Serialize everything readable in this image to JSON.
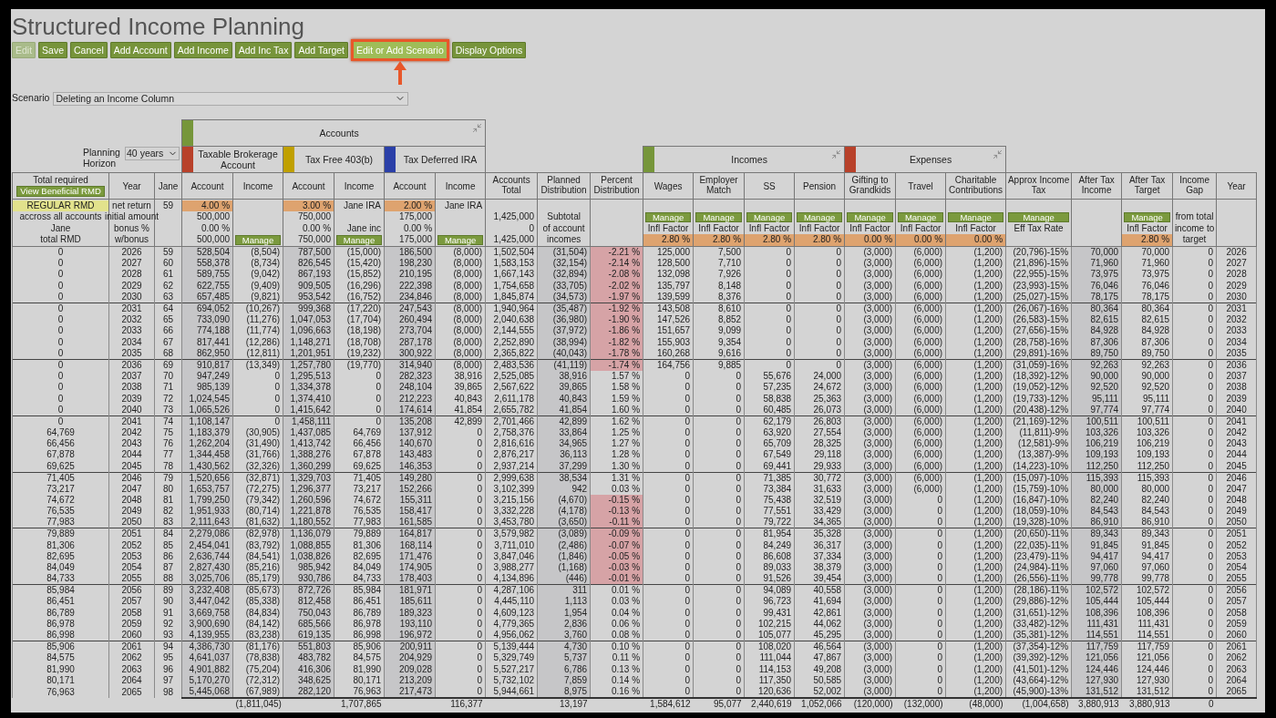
{
  "title": "Structured Income Planning",
  "toolbar": [
    {
      "label": "Edit",
      "disabled": true,
      "highlighted": false
    },
    {
      "label": "Save",
      "disabled": false,
      "highlighted": false
    },
    {
      "label": "Cancel",
      "disabled": false,
      "highlighted": false
    },
    {
      "label": "Add Account",
      "disabled": false,
      "highlighted": false
    },
    {
      "label": "Add Income",
      "disabled": false,
      "highlighted": false
    },
    {
      "label": "Add Inc Tax",
      "disabled": false,
      "highlighted": false
    },
    {
      "label": "Add Target",
      "disabled": false,
      "highlighted": false
    },
    {
      "label": "Edit or Add Scenario",
      "disabled": false,
      "highlighted": true
    },
    {
      "label": "Display Options",
      "disabled": false,
      "highlighted": false
    }
  ],
  "scenario": {
    "label": "Scenario",
    "value": "Deleting an Income Column"
  },
  "planning_horizon": {
    "label": "Planning Horizon",
    "value": "40 years"
  },
  "account_group": {
    "label": "Accounts",
    "color": "#76963a",
    "accounts": [
      {
        "label": "Taxable Brokerage Account",
        "color": "#b8412a"
      },
      {
        "label": "Tax Free 403(b)",
        "color": "#c0a000"
      },
      {
        "label": "Tax Deferred IRA",
        "color": "#2a3fa8"
      }
    ]
  },
  "flow_groups": [
    {
      "label": "Incomes",
      "color": "#76963a"
    },
    {
      "label": "Expenses",
      "color": "#b8412a"
    }
  ],
  "columns": [
    {
      "header": "Total required",
      "kind": "rmd",
      "shaded": false,
      "button": "View Beneficial RMD",
      "settings": [
        {
          "kind": "flag",
          "text": "REGULAR RMD"
        },
        {
          "kind": "text",
          "text": "accross all accounts"
        },
        {
          "kind": "text",
          "text": "Jane"
        },
        {
          "kind": "text",
          "text": "total RMD"
        }
      ]
    },
    {
      "header": "Year",
      "kind": "year",
      "shaded": false,
      "settings": [
        {
          "kind": "text",
          "text": "net return"
        },
        {
          "kind": "text",
          "text": "initial amount"
        },
        {
          "kind": "text",
          "text": "bonus %"
        },
        {
          "kind": "text",
          "text": "w/bonus"
        }
      ]
    },
    {
      "header": "Jane",
      "kind": "age",
      "shaded": false,
      "settings": [
        {
          "kind": "text",
          "text": "59"
        },
        {
          "kind": "blank"
        },
        {
          "kind": "blank"
        },
        {
          "kind": "blank"
        }
      ]
    },
    {
      "header": "Account",
      "kind": "amount",
      "shaded": true,
      "settings": [
        {
          "kind": "rate",
          "text": "4.00 %"
        },
        {
          "kind": "value",
          "text": "500,000"
        },
        {
          "kind": "value",
          "text": "0.00 %"
        },
        {
          "kind": "value",
          "text": "500,000"
        }
      ]
    },
    {
      "header": "Income",
      "kind": "amount",
      "shaded": false,
      "total": "(1,811,045)",
      "settings": [
        {
          "kind": "blank"
        },
        {
          "kind": "blank"
        },
        {
          "kind": "blank"
        },
        {
          "kind": "manage",
          "text": "Manage"
        }
      ]
    },
    {
      "header": "Account",
      "kind": "amount",
      "shaded": true,
      "settings": [
        {
          "kind": "rate",
          "text": "3.00 %"
        },
        {
          "kind": "value",
          "text": "750,000"
        },
        {
          "kind": "value",
          "text": "0.00 %"
        },
        {
          "kind": "value",
          "text": "750,000"
        }
      ]
    },
    {
      "header": "Income",
      "kind": "amount",
      "shaded": false,
      "total": "1,707,865",
      "settings": [
        {
          "kind": "value",
          "text": "Jane IRA"
        },
        {
          "kind": "blank"
        },
        {
          "kind": "value",
          "text": "Jane inc"
        },
        {
          "kind": "manage",
          "text": "Manage"
        }
      ]
    },
    {
      "header": "Account",
      "kind": "amount",
      "shaded": true,
      "settings": [
        {
          "kind": "rate",
          "text": "2.00 %"
        },
        {
          "kind": "value",
          "text": "175,000"
        },
        {
          "kind": "value",
          "text": "0.00 %"
        },
        {
          "kind": "value",
          "text": "175,000"
        }
      ]
    },
    {
      "header": "Income",
      "kind": "amount",
      "shaded": false,
      "total": "116,377",
      "settings": [
        {
          "kind": "value",
          "text": "Jane IRA"
        },
        {
          "kind": "blank"
        },
        {
          "kind": "blank"
        },
        {
          "kind": "manage",
          "text": "Manage"
        }
      ]
    },
    {
      "header": "Accounts Total",
      "kind": "amount",
      "shaded": false,
      "settings": [
        {
          "kind": "blank"
        },
        {
          "kind": "value",
          "text": "1,425,000"
        },
        {
          "kind": "value",
          "text": "0"
        },
        {
          "kind": "value",
          "text": "1,425,000"
        }
      ]
    },
    {
      "header": "Planned Distribution",
      "kind": "amount",
      "shaded": true,
      "total": "13,197",
      "settings": [
        {
          "kind": "blank"
        },
        {
          "kind": "text",
          "text": "Subtotal"
        },
        {
          "kind": "text",
          "text": "of account"
        },
        {
          "kind": "text",
          "text": "incomes"
        }
      ]
    },
    {
      "header": "Percent Distribution",
      "kind": "percent",
      "shaded": false,
      "settings": [
        {
          "kind": "blank"
        },
        {
          "kind": "blank"
        },
        {
          "kind": "blank"
        },
        {
          "kind": "blank"
        }
      ]
    },
    {
      "header": "Wages",
      "kind": "amount",
      "shaded": false,
      "total": "1,584,612",
      "settings": [
        {
          "kind": "blank"
        },
        {
          "kind": "manage",
          "text": "Manage"
        },
        {
          "kind": "text",
          "text": "Infl Factor"
        },
        {
          "kind": "rate",
          "text": "2.80 %"
        }
      ]
    },
    {
      "header": "Employer Match",
      "kind": "amount",
      "shaded": false,
      "total": "95,077",
      "settings": [
        {
          "kind": "blank"
        },
        {
          "kind": "manage",
          "text": "Manage"
        },
        {
          "kind": "text",
          "text": "Infl Factor"
        },
        {
          "kind": "rate",
          "text": "2.80 %"
        }
      ]
    },
    {
      "header": "SS",
      "kind": "amount",
      "shaded": false,
      "total": "2,440,619",
      "settings": [
        {
          "kind": "blank"
        },
        {
          "kind": "manage",
          "text": "Manage"
        },
        {
          "kind": "text",
          "text": "Infl Factor"
        },
        {
          "kind": "rate",
          "text": "2.80 %"
        }
      ]
    },
    {
      "header": "Pension",
      "kind": "amount",
      "shaded": false,
      "total": "1,052,066",
      "settings": [
        {
          "kind": "blank"
        },
        {
          "kind": "manage",
          "text": "Manage"
        },
        {
          "kind": "text",
          "text": "Infl Factor"
        },
        {
          "kind": "rate",
          "text": "2.80 %"
        }
      ]
    },
    {
      "header": "Gifting to Grandkids",
      "kind": "amount",
      "shaded": false,
      "total": "(120,000)",
      "settings": [
        {
          "kind": "blank"
        },
        {
          "kind": "manage",
          "text": "Manage"
        },
        {
          "kind": "text",
          "text": "Infl Factor"
        },
        {
          "kind": "rate",
          "text": "0.00 %"
        }
      ]
    },
    {
      "header": "Travel",
      "kind": "amount",
      "shaded": false,
      "total": "(132,000)",
      "settings": [
        {
          "kind": "blank"
        },
        {
          "kind": "manage",
          "text": "Manage"
        },
        {
          "kind": "text",
          "text": "Infl Factor"
        },
        {
          "kind": "rate",
          "text": "0.00 %"
        }
      ]
    },
    {
      "header": "Charitable Contributions",
      "kind": "amount",
      "shaded": false,
      "total": "(48,000)",
      "settings": [
        {
          "kind": "blank"
        },
        {
          "kind": "manage",
          "text": "Manage"
        },
        {
          "kind": "text",
          "text": "Infl Factor"
        },
        {
          "kind": "rate",
          "text": "0.00 %"
        }
      ]
    },
    {
      "header": "Approx Income Tax",
      "kind": "amount",
      "shaded": false,
      "total": "(1,004,658)",
      "settings": [
        {
          "kind": "blank"
        },
        {
          "kind": "manage",
          "text": "Manage"
        },
        {
          "kind": "text",
          "text": "Eff Tax Rate"
        },
        {
          "kind": "blank"
        }
      ]
    },
    {
      "header": "After Tax Income",
      "kind": "amount",
      "shaded": true,
      "total": "3,880,913",
      "settings": [
        {
          "kind": "blank"
        },
        {
          "kind": "blank"
        },
        {
          "kind": "blank"
        },
        {
          "kind": "blank"
        }
      ]
    },
    {
      "header": "After Tax Target",
      "kind": "amount",
      "shaded": false,
      "total": "3,880,913",
      "settings": [
        {
          "kind": "blank"
        },
        {
          "kind": "manage",
          "text": "Manage"
        },
        {
          "kind": "text",
          "text": "Infl Factor"
        },
        {
          "kind": "rate",
          "text": "2.80 %"
        }
      ]
    },
    {
      "header": "Income Gap",
      "kind": "amount",
      "shaded": false,
      "total": "0",
      "settings": [
        {
          "kind": "blank"
        },
        {
          "kind": "text",
          "text": "from total"
        },
        {
          "kind": "text",
          "text": "income to"
        },
        {
          "kind": "text",
          "text": "target"
        }
      ]
    },
    {
      "header": "Year",
      "kind": "year",
      "shaded": false,
      "settings": [
        {
          "kind": "blank"
        },
        {
          "kind": "blank"
        },
        {
          "kind": "blank"
        },
        {
          "kind": "blank"
        }
      ]
    }
  ],
  "rows": [
    {
      "negative": true,
      "cells": [
        "0",
        "2026",
        "59",
        "528,504",
        "(8,504)",
        "787,500",
        "(15,000)",
        "186,500",
        "(8,000)",
        "1,502,504",
        "(31,504)",
        "-2.21 %",
        "125,000",
        "7,500",
        "0",
        "0",
        "(3,000)",
        "(6,000)",
        "(1,200)",
        "(20,796)-15%",
        "70,000",
        "70,000",
        "0",
        "2026"
      ]
    },
    {
      "negative": true,
      "cells": [
        "0",
        "2027",
        "60",
        "558,378",
        "(8,734)",
        "826,545",
        "(15,420)",
        "198,230",
        "(8,000)",
        "1,583,153",
        "(32,154)",
        "-2.14 %",
        "128,500",
        "7,710",
        "0",
        "0",
        "(3,000)",
        "(6,000)",
        "(1,200)",
        "(21,896)-15%",
        "71,960",
        "71,960",
        "0",
        "2027"
      ]
    },
    {
      "negative": true,
      "cells": [
        "0",
        "2028",
        "61",
        "589,755",
        "(9,042)",
        "867,193",
        "(15,852)",
        "210,195",
        "(8,000)",
        "1,667,143",
        "(32,894)",
        "-2.08 %",
        "132,098",
        "7,926",
        "0",
        "0",
        "(3,000)",
        "(6,000)",
        "(1,200)",
        "(22,955)-15%",
        "73,975",
        "73,975",
        "0",
        "2028"
      ]
    },
    {
      "negative": true,
      "cells": [
        "0",
        "2029",
        "62",
        "622,755",
        "(9,409)",
        "909,505",
        "(16,296)",
        "222,398",
        "(8,000)",
        "1,754,658",
        "(33,705)",
        "-2.02 %",
        "135,797",
        "8,148",
        "0",
        "0",
        "(3,000)",
        "(6,000)",
        "(1,200)",
        "(23,993)-15%",
        "76,046",
        "76,046",
        "0",
        "2029"
      ]
    },
    {
      "negative": true,
      "cells": [
        "0",
        "2030",
        "63",
        "657,485",
        "(9,821)",
        "953,542",
        "(16,752)",
        "234,846",
        "(8,000)",
        "1,845,874",
        "(34,573)",
        "-1.97 %",
        "139,599",
        "8,376",
        "0",
        "0",
        "(3,000)",
        "(6,000)",
        "(1,200)",
        "(25,027)-15%",
        "78,175",
        "78,175",
        "0",
        "2030"
      ]
    },
    {
      "negative": true,
      "cells": [
        "0",
        "2031",
        "64",
        "694,052",
        "(10,267)",
        "999,368",
        "(17,220)",
        "247,543",
        "(8,000)",
        "1,940,964",
        "(35,487)",
        "-1.92 %",
        "143,508",
        "8,610",
        "0",
        "0",
        "(3,000)",
        "(6,000)",
        "(1,200)",
        "(26,067)-16%",
        "80,364",
        "80,364",
        "0",
        "2031"
      ]
    },
    {
      "negative": true,
      "cells": [
        "0",
        "2032",
        "65",
        "733,090",
        "(11,276)",
        "1,047,053",
        "(17,704)",
        "260,494",
        "(8,000)",
        "2,040,638",
        "(36,980)",
        "-1.90 %",
        "147,526",
        "8,852",
        "0",
        "0",
        "(3,000)",
        "(6,000)",
        "(1,200)",
        "(26,583)-15%",
        "82,615",
        "82,615",
        "0",
        "2032"
      ]
    },
    {
      "negative": true,
      "cells": [
        "0",
        "2033",
        "66",
        "774,188",
        "(11,774)",
        "1,096,663",
        "(18,198)",
        "273,704",
        "(8,000)",
        "2,144,555",
        "(37,972)",
        "-1.86 %",
        "151,657",
        "9,099",
        "0",
        "0",
        "(3,000)",
        "(6,000)",
        "(1,200)",
        "(27,656)-15%",
        "84,928",
        "84,928",
        "0",
        "2033"
      ]
    },
    {
      "negative": true,
      "cells": [
        "0",
        "2034",
        "67",
        "817,441",
        "(12,286)",
        "1,148,271",
        "(18,708)",
        "287,178",
        "(8,000)",
        "2,252,890",
        "(38,994)",
        "-1.82 %",
        "155,903",
        "9,354",
        "0",
        "0",
        "(3,000)",
        "(6,000)",
        "(1,200)",
        "(28,758)-16%",
        "87,306",
        "87,306",
        "0",
        "2034"
      ]
    },
    {
      "negative": true,
      "cells": [
        "0",
        "2035",
        "68",
        "862,950",
        "(12,811)",
        "1,201,951",
        "(19,232)",
        "300,922",
        "(8,000)",
        "2,365,822",
        "(40,043)",
        "-1.78 %",
        "160,268",
        "9,616",
        "0",
        "0",
        "(3,000)",
        "(6,000)",
        "(1,200)",
        "(29,891)-16%",
        "89,750",
        "89,750",
        "0",
        "2035"
      ]
    },
    {
      "negative": true,
      "cells": [
        "0",
        "2036",
        "69",
        "910,817",
        "(13,349)",
        "1,257,780",
        "(19,770)",
        "314,940",
        "(8,000)",
        "2,483,536",
        "(41,119)",
        "-1.74 %",
        "164,756",
        "9,885",
        "0",
        "0",
        "(3,000)",
        "(6,000)",
        "(1,200)",
        "(31,059)-16%",
        "92,263",
        "92,263",
        "0",
        "2036"
      ]
    },
    {
      "negative": false,
      "cells": [
        "0",
        "2037",
        "70",
        "947,249",
        "0",
        "1,295,513",
        "0",
        "282,323",
        "38,916",
        "2,525,085",
        "38,916",
        "1.57 %",
        "0",
        "0",
        "55,676",
        "24,000",
        "(3,000)",
        "(6,000)",
        "(1,200)",
        "(18,392)-12%",
        "90,000",
        "90,000",
        "0",
        "2037"
      ]
    },
    {
      "negative": false,
      "cells": [
        "0",
        "2038",
        "71",
        "985,139",
        "0",
        "1,334,378",
        "0",
        "248,104",
        "39,865",
        "2,567,622",
        "39,865",
        "1.58 %",
        "0",
        "0",
        "57,235",
        "24,672",
        "(3,000)",
        "(6,000)",
        "(1,200)",
        "(19,052)-12%",
        "92,520",
        "92,520",
        "0",
        "2038"
      ]
    },
    {
      "negative": false,
      "cells": [
        "0",
        "2039",
        "72",
        "1,024,545",
        "0",
        "1,374,410",
        "0",
        "212,223",
        "40,843",
        "2,611,178",
        "40,843",
        "1.59 %",
        "0",
        "0",
        "58,838",
        "25,363",
        "(3,000)",
        "(6,000)",
        "(1,200)",
        "(19,733)-12%",
        "95,111",
        "95,111",
        "0",
        "2039"
      ]
    },
    {
      "negative": false,
      "cells": [
        "0",
        "2040",
        "73",
        "1,065,526",
        "0",
        "1,415,642",
        "0",
        "174,614",
        "41,854",
        "2,655,782",
        "41,854",
        "1.60 %",
        "0",
        "0",
        "60,485",
        "26,073",
        "(3,000)",
        "(6,000)",
        "(1,200)",
        "(20,438)-12%",
        "97,774",
        "97,774",
        "0",
        "2040"
      ]
    },
    {
      "negative": false,
      "cells": [
        "0",
        "2041",
        "74",
        "1,108,147",
        "0",
        "1,458,111",
        "0",
        "135,208",
        "42,899",
        "2,701,466",
        "42,899",
        "1.62 %",
        "0",
        "0",
        "62,179",
        "26,803",
        "(3,000)",
        "(6,000)",
        "(1,200)",
        "(21,169)-12%",
        "100,511",
        "100,511",
        "0",
        "2041"
      ]
    },
    {
      "negative": false,
      "cells": [
        "64,769",
        "2042",
        "75",
        "1,183,379",
        "(30,905)",
        "1,437,085",
        "64,769",
        "137,912",
        "0",
        "2,758,376",
        "33,864",
        "1.25 %",
        "0",
        "0",
        "63,920",
        "27,554",
        "(3,000)",
        "(6,000)",
        "(1,200)",
        "(11,811)-9%",
        "103,326",
        "103,326",
        "0",
        "2042"
      ]
    },
    {
      "negative": false,
      "cells": [
        "66,456",
        "2043",
        "76",
        "1,262,204",
        "(31,490)",
        "1,413,742",
        "66,456",
        "140,670",
        "0",
        "2,816,616",
        "34,965",
        "1.27 %",
        "0",
        "0",
        "65,709",
        "28,325",
        "(3,000)",
        "(6,000)",
        "(1,200)",
        "(12,581)-9%",
        "106,219",
        "106,219",
        "0",
        "2043"
      ]
    },
    {
      "negative": false,
      "cells": [
        "67,878",
        "2044",
        "77",
        "1,344,458",
        "(31,766)",
        "1,388,276",
        "67,878",
        "143,483",
        "0",
        "2,876,217",
        "36,113",
        "1.28 %",
        "0",
        "0",
        "67,549",
        "29,118",
        "(3,000)",
        "(6,000)",
        "(1,200)",
        "(13,387)-9%",
        "109,193",
        "109,193",
        "0",
        "2044"
      ]
    },
    {
      "negative": false,
      "cells": [
        "69,625",
        "2045",
        "78",
        "1,430,562",
        "(32,326)",
        "1,360,299",
        "69,625",
        "146,353",
        "0",
        "2,937,214",
        "37,299",
        "1.30 %",
        "0",
        "0",
        "69,441",
        "29,933",
        "(3,000)",
        "(6,000)",
        "(1,200)",
        "(14,223)-10%",
        "112,250",
        "112,250",
        "0",
        "2045"
      ]
    },
    {
      "negative": false,
      "cells": [
        "71,405",
        "2046",
        "79",
        "1,520,656",
        "(32,871)",
        "1,329,703",
        "71,405",
        "149,280",
        "0",
        "2,999,638",
        "38,534",
        "1.31 %",
        "0",
        "0",
        "71,385",
        "30,772",
        "(3,000)",
        "(6,000)",
        "(1,200)",
        "(15,097)-10%",
        "115,393",
        "115,393",
        "0",
        "2046"
      ]
    },
    {
      "negative": false,
      "cells": [
        "73,217",
        "2047",
        "80",
        "1,653,757",
        "(72,275)",
        "1,296,377",
        "73,217",
        "152,266",
        "0",
        "3,102,399",
        "942",
        "0.03 %",
        "0",
        "0",
        "73,384",
        "31,633",
        "(3,000)",
        "(6,000)",
        "(1,200)",
        "(15,759)-10%",
        "80,000",
        "80,000",
        "0",
        "2047"
      ]
    },
    {
      "negative": true,
      "cells": [
        "74,672",
        "2048",
        "81",
        "1,799,250",
        "(79,342)",
        "1,260,596",
        "74,672",
        "155,311",
        "0",
        "3,215,156",
        "(4,670)",
        "-0.15 %",
        "0",
        "0",
        "75,438",
        "32,519",
        "(3,000)",
        "0",
        "(1,200)",
        "(16,847)-10%",
        "82,240",
        "82,240",
        "0",
        "2048"
      ]
    },
    {
      "negative": true,
      "cells": [
        "76,535",
        "2049",
        "82",
        "1,951,933",
        "(80,714)",
        "1,221,878",
        "76,535",
        "158,417",
        "0",
        "3,332,228",
        "(4,178)",
        "-0.13 %",
        "0",
        "0",
        "77,551",
        "33,429",
        "(3,000)",
        "0",
        "(1,200)",
        "(18,059)-10%",
        "84,543",
        "84,543",
        "0",
        "2049"
      ]
    },
    {
      "negative": true,
      "cells": [
        "77,983",
        "2050",
        "83",
        "2,111,643",
        "(81,632)",
        "1,180,552",
        "77,983",
        "161,585",
        "0",
        "3,453,780",
        "(3,650)",
        "-0.11 %",
        "0",
        "0",
        "79,722",
        "34,365",
        "(3,000)",
        "0",
        "(1,200)",
        "(19,328)-10%",
        "86,910",
        "86,910",
        "0",
        "2050"
      ]
    },
    {
      "negative": true,
      "cells": [
        "79,889",
        "2051",
        "84",
        "2,279,086",
        "(82,978)",
        "1,136,079",
        "79,889",
        "164,817",
        "0",
        "3,579,982",
        "(3,089)",
        "-0.09 %",
        "0",
        "0",
        "81,954",
        "35,328",
        "(3,000)",
        "0",
        "(1,200)",
        "(20,650)-11%",
        "89,343",
        "89,343",
        "0",
        "2051"
      ]
    },
    {
      "negative": true,
      "cells": [
        "81,306",
        "2052",
        "85",
        "2,454,041",
        "(83,792)",
        "1,088,855",
        "81,306",
        "168,114",
        "0",
        "3,711,010",
        "(2,486)",
        "-0.07 %",
        "0",
        "0",
        "84,249",
        "36,317",
        "(3,000)",
        "0",
        "(1,200)",
        "(22,035)-11%",
        "91,845",
        "91,845",
        "0",
        "2052"
      ]
    },
    {
      "negative": true,
      "cells": [
        "82,695",
        "2053",
        "86",
        "2,636,744",
        "(84,541)",
        "1,038,826",
        "82,695",
        "171,476",
        "0",
        "3,847,046",
        "(1,846)",
        "-0.05 %",
        "0",
        "0",
        "86,608",
        "37,334",
        "(3,000)",
        "0",
        "(1,200)",
        "(23,479)-11%",
        "94,417",
        "94,417",
        "0",
        "2053"
      ]
    },
    {
      "negative": true,
      "cells": [
        "84,049",
        "2054",
        "87",
        "2,827,430",
        "(85,216)",
        "985,942",
        "84,049",
        "174,905",
        "0",
        "3,988,277",
        "(1,168)",
        "-0.03 %",
        "0",
        "0",
        "89,033",
        "38,379",
        "(3,000)",
        "0",
        "(1,200)",
        "(24,984)-11%",
        "97,060",
        "97,060",
        "0",
        "2054"
      ]
    },
    {
      "negative": true,
      "cells": [
        "84,733",
        "2055",
        "88",
        "3,025,706",
        "(85,179)",
        "930,786",
        "84,733",
        "178,403",
        "0",
        "4,134,896",
        "(446)",
        "-0.01 %",
        "0",
        "0",
        "91,526",
        "39,454",
        "(3,000)",
        "0",
        "(1,200)",
        "(26,556)-11%",
        "99,778",
        "99,778",
        "0",
        "2055"
      ]
    },
    {
      "negative": false,
      "cells": [
        "85,984",
        "2056",
        "89",
        "3,232,408",
        "(85,673)",
        "872,726",
        "85,984",
        "181,971",
        "0",
        "4,287,106",
        "311",
        "0.01 %",
        "0",
        "0",
        "94,089",
        "40,558",
        "(3,000)",
        "0",
        "(1,200)",
        "(28,186)-11%",
        "102,572",
        "102,572",
        "0",
        "2056"
      ]
    },
    {
      "negative": false,
      "cells": [
        "86,451",
        "2057",
        "90",
        "3,447,042",
        "(85,338)",
        "812,458",
        "86,451",
        "185,611",
        "0",
        "4,445,110",
        "1,113",
        "0.03 %",
        "0",
        "0",
        "96,723",
        "41,694",
        "(3,000)",
        "0",
        "(1,200)",
        "(29,886)-12%",
        "105,444",
        "105,444",
        "0",
        "2057"
      ]
    },
    {
      "negative": false,
      "cells": [
        "86,789",
        "2058",
        "91",
        "3,669,758",
        "(84,834)",
        "750,043",
        "86,789",
        "189,323",
        "0",
        "4,609,123",
        "1,954",
        "0.04 %",
        "0",
        "0",
        "99,431",
        "42,861",
        "(3,000)",
        "0",
        "(1,200)",
        "(31,651)-12%",
        "108,396",
        "108,396",
        "0",
        "2058"
      ]
    },
    {
      "negative": false,
      "cells": [
        "86,978",
        "2059",
        "92",
        "3,900,690",
        "(84,142)",
        "685,566",
        "86,978",
        "193,110",
        "0",
        "4,779,365",
        "2,836",
        "0.06 %",
        "0",
        "0",
        "102,215",
        "44,062",
        "(3,000)",
        "0",
        "(1,200)",
        "(33,482)-12%",
        "111,431",
        "111,431",
        "0",
        "2059"
      ]
    },
    {
      "negative": false,
      "cells": [
        "86,998",
        "2060",
        "93",
        "4,139,955",
        "(83,238)",
        "619,135",
        "86,998",
        "196,972",
        "0",
        "4,956,062",
        "3,760",
        "0.08 %",
        "0",
        "0",
        "105,077",
        "45,295",
        "(3,000)",
        "0",
        "(1,200)",
        "(35,381)-12%",
        "114,551",
        "114,551",
        "0",
        "2060"
      ]
    },
    {
      "negative": false,
      "cells": [
        "85,906",
        "2061",
        "94",
        "4,386,730",
        "(81,176)",
        "551,803",
        "85,906",
        "200,911",
        "0",
        "5,139,444",
        "4,730",
        "0.10 %",
        "0",
        "0",
        "108,020",
        "46,564",
        "(3,000)",
        "0",
        "(1,200)",
        "(37,354)-12%",
        "117,759",
        "117,759",
        "0",
        "2061"
      ]
    },
    {
      "negative": false,
      "cells": [
        "84,575",
        "2062",
        "95",
        "4,641,037",
        "(78,838)",
        "483,782",
        "84,575",
        "204,929",
        "0",
        "5,329,749",
        "5,737",
        "0.11 %",
        "0",
        "0",
        "111,044",
        "47,867",
        "(3,000)",
        "0",
        "(1,200)",
        "(39,392)-12%",
        "121,056",
        "121,056",
        "0",
        "2062"
      ]
    },
    {
      "negative": false,
      "cells": [
        "81,990",
        "2063",
        "96",
        "4,901,882",
        "(75,204)",
        "416,306",
        "81,990",
        "209,028",
        "0",
        "5,527,217",
        "6,786",
        "0.13 %",
        "0",
        "0",
        "114,153",
        "49,208",
        "(3,000)",
        "0",
        "(1,200)",
        "(41,501)-12%",
        "124,446",
        "124,446",
        "0",
        "2063"
      ]
    },
    {
      "negative": false,
      "cells": [
        "80,171",
        "2064",
        "97",
        "5,170,270",
        "(72,312)",
        "348,625",
        "80,171",
        "213,209",
        "0",
        "5,732,102",
        "7,859",
        "0.14 %",
        "0",
        "0",
        "117,350",
        "50,585",
        "(3,000)",
        "0",
        "(1,200)",
        "(43,664)-12%",
        "127,930",
        "127,930",
        "0",
        "2064"
      ]
    },
    {
      "negative": false,
      "cells": [
        "76,963",
        "2065",
        "98",
        "5,445,068",
        "(67,989)",
        "282,120",
        "76,963",
        "217,473",
        "0",
        "5,944,661",
        "8,975",
        "0.16 %",
        "0",
        "0",
        "120,636",
        "52,002",
        "(3,000)",
        "0",
        "(1,200)",
        "(45,900)-13%",
        "131,512",
        "131,512",
        "0",
        "2065"
      ]
    }
  ]
}
